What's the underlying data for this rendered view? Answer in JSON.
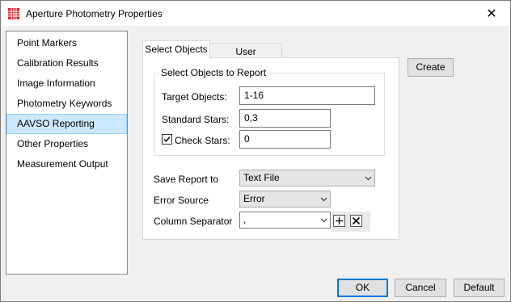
{
  "window": {
    "title": "Aperture Photometry Properties",
    "close_glyph": "✕",
    "app_icon": "red-grid-icon"
  },
  "sidebar": {
    "items": [
      {
        "label": "Point Markers"
      },
      {
        "label": "Calibration Results"
      },
      {
        "label": "Image Information"
      },
      {
        "label": "Photometry Keywords"
      },
      {
        "label": "AAVSO Reporting",
        "selected": true
      },
      {
        "label": "Other Properties"
      },
      {
        "label": "Measurement Output"
      }
    ]
  },
  "tabs": [
    {
      "label": "Select Objects",
      "active": true
    },
    {
      "label": "User Information",
      "active": false
    }
  ],
  "select_group": {
    "legend": "Select Objects to Report",
    "target_label": "Target Objects:",
    "target_value": "1-16",
    "standard_label": "Standard Stars:",
    "standard_value": "0,3",
    "check_label": "Check Stars:",
    "check_value": "0",
    "check_checked": true
  },
  "report": {
    "save_label": "Save Report to",
    "save_value": "Text File",
    "error_label": "Error Source",
    "error_value": "Error",
    "separator_label": "Column Separator",
    "separator_value": ","
  },
  "buttons": {
    "create": "Create",
    "ok": "OK",
    "cancel": "Cancel",
    "default": "Default"
  },
  "colors": {
    "selection_bg": "#cce8ff",
    "accent": "#0078d7",
    "icon_red": "#d9232d"
  }
}
